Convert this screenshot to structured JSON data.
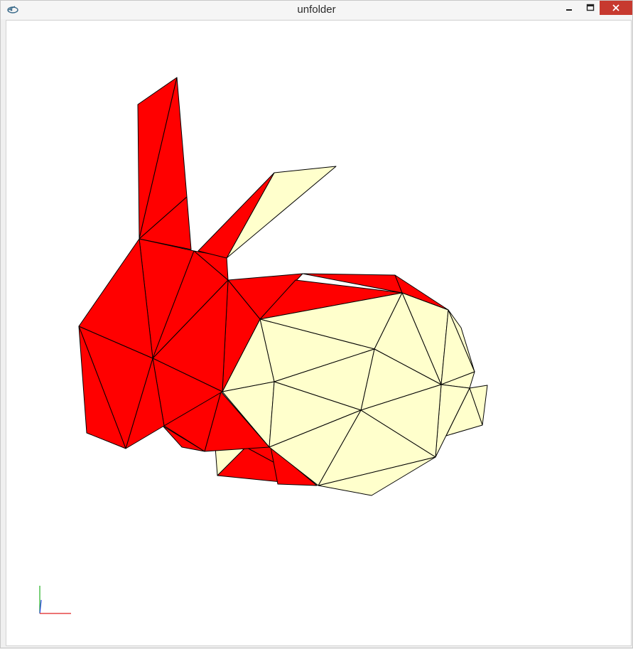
{
  "window": {
    "title": "unfolder"
  },
  "icons": {
    "app": "app-icon",
    "minimize": "minimize-icon",
    "maximize": "maximize-icon",
    "close": "close-icon"
  },
  "colors": {
    "unfolded_face": "#ff0000",
    "folded_face": "#ffffcc",
    "edge": "#000000",
    "axis_x": "#e02020",
    "axis_y": "#20b020",
    "axis_z": "#2040e0",
    "close_button": "#c7392f"
  }
}
